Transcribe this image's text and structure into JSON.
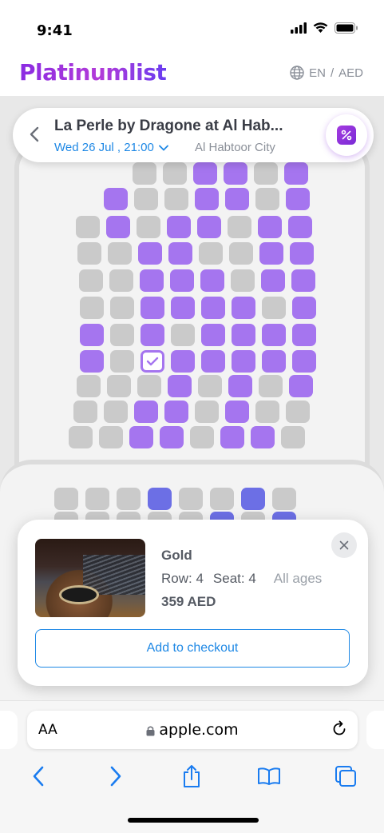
{
  "status": {
    "time": "9:41"
  },
  "brand": {
    "logo": "Platinumlist",
    "lang": "EN",
    "separator": "/",
    "currency": "AED"
  },
  "event": {
    "title": "La Perle by Dragone at Al Hab...",
    "date": "Wed 26 Jul , 21:00",
    "venue": "Al Habtoor City"
  },
  "seat_card": {
    "tier": "Gold",
    "row_label": "Row: 4",
    "seat_label": "Seat: 4",
    "age": "All ages",
    "price": "359 AED",
    "checkout_label": "Add to checkout"
  },
  "browser": {
    "aa": "AA",
    "url": "apple.com"
  },
  "colors": {
    "accent_purple": "#a575ef",
    "seat_gray": "#cacaca",
    "link_blue": "#1e88e5",
    "seat_blue": "#6c6fe5"
  },
  "icons": [
    "back-chevron-icon",
    "chevron-down-icon",
    "promo-percent-icon",
    "globe-icon",
    "close-icon",
    "lock-icon",
    "reload-icon",
    "nav-back-icon",
    "nav-forward-icon",
    "share-icon",
    "bookmarks-icon",
    "tabs-icon"
  ]
}
